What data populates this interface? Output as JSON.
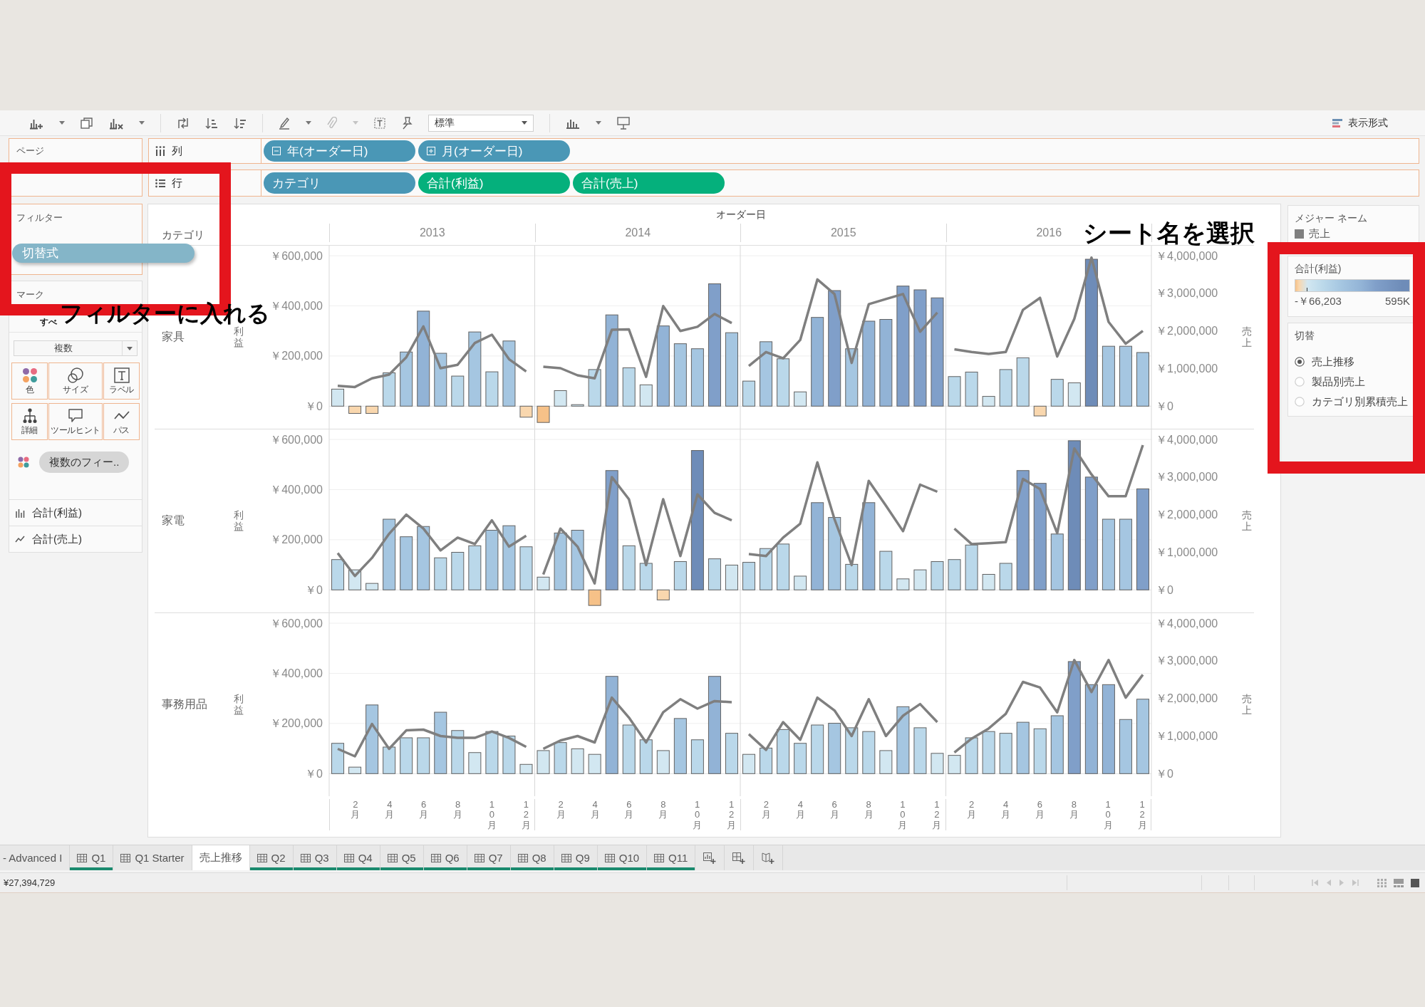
{
  "toolbar": {
    "fit": "標準",
    "show_me": "表示形式"
  },
  "shelves": {
    "pages": {
      "label": "ページ"
    },
    "columns": {
      "label": "列",
      "pills": [
        {
          "label": "年(オーダー日)",
          "kind": "discrete",
          "expanded": true
        },
        {
          "label": "月(オーダー日)",
          "kind": "discrete",
          "expanded": false
        }
      ]
    },
    "rows": {
      "label": "行",
      "pills": [
        {
          "label": "カテゴリ",
          "kind": "discrete"
        },
        {
          "label": "合計(利益)",
          "kind": "continuous"
        },
        {
          "label": "合計(売上)",
          "kind": "continuous"
        }
      ]
    }
  },
  "filters": {
    "label": "フィルター",
    "dragged_pill": {
      "label": "切替式",
      "kind": "discrete"
    },
    "callout": "フィルターに入れる"
  },
  "marks": {
    "label": "マーク",
    "all_tab": {
      "label": "すべ",
      "selected": true
    },
    "mark_type": "複数",
    "buttons": [
      {
        "label": "色",
        "kind": "color"
      },
      {
        "label": "サイズ",
        "kind": "size"
      },
      {
        "label": "ラベル",
        "kind": "label"
      },
      {
        "label": "詳細",
        "kind": "detail"
      },
      {
        "label": "ツールヒント",
        "kind": "tooltip"
      },
      {
        "label": "パス",
        "kind": "path"
      }
    ],
    "fields": [
      {
        "label": "複数のフィー..",
        "kind": "color"
      }
    ],
    "measure_tabs": [
      {
        "label": "合計(利益)",
        "kind": "bar",
        "selected": false
      },
      {
        "label": "合計(売上)",
        "kind": "line",
        "selected": false
      }
    ]
  },
  "view": {
    "row_header": "カテゴリ",
    "column_header": "オーダー日",
    "years": [
      "2013",
      "2014",
      "2015",
      "2016"
    ],
    "rows": [
      {
        "label": "家具"
      },
      {
        "label": "家電"
      },
      {
        "label": "事務用品"
      }
    ],
    "chart_data": [
      {
        "type": "bar",
        "ylabel": "利益",
        "y2label": "売上",
        "grid": true,
        "series": [
          {
            "values": [
              68000,
              -29000,
              -29000,
              133000,
              216000,
              379000,
              211000,
              120000,
              296000,
              137000,
              260000,
              -44000,
              -65000,
              62000,
              6000,
              146000,
              364000,
              153000,
              85000,
              320000,
              249000,
              229000,
              488000,
              293000,
              100000,
              257000,
              189000,
              57000,
              354000,
              461000,
              229000,
              339000,
              346000,
              479000,
              464000,
              432000,
              118000,
              136000,
              39000,
              146000,
              193000,
              -39000,
              107000,
              93000,
              586000,
              239000,
              239000,
              214000
            ],
            "colors": [
              "#d2e7f1",
              "#f9d7ae",
              "#f9d7ae",
              "#bad8ea",
              "#a5c6e1",
              "#92b3d6",
              "#a5c6e1",
              "#bad8ea",
              "#a5c6e1",
              "#bad8ea",
              "#a5c6e1",
              "#f9d7ae",
              "#f6c188",
              "#d2e7f1",
              "#d2e7f1",
              "#bad8ea",
              "#92b3d6",
              "#bad8ea",
              "#d2e7f1",
              "#92b3d6",
              "#a5c6e1",
              "#a5c6e1",
              "#809fc9",
              "#a5c6e1",
              "#bad8ea",
              "#a5c6e1",
              "#bad8ea",
              "#d2e7f1",
              "#92b3d6",
              "#809fc9",
              "#a5c6e1",
              "#92b3d6",
              "#92b3d6",
              "#809fc9",
              "#809fc9",
              "#809fc9",
              "#bad8ea",
              "#bad8ea",
              "#d2e7f1",
              "#bad8ea",
              "#bad8ea",
              "#f9d7ae",
              "#bad8ea",
              "#d2e7f1",
              "#6e8cb8",
              "#a5c6e1",
              "#a5c6e1",
              "#a5c6e1"
            ]
          },
          {
            "type": "line",
            "axis": "y2",
            "color": "#7f7f7f",
            "values": [
              540000,
              510000,
              740000,
              840000,
              1300000,
              2120000,
              1010000,
              1100000,
              1680000,
              1900000,
              1250000,
              920000,
              1050000,
              1010000,
              820000,
              740000,
              2030000,
              2040000,
              780000,
              2660000,
              2000000,
              2110000,
              2450000,
              2210000,
              1070000,
              1440000,
              1270000,
              1760000,
              3370000,
              2980000,
              1150000,
              2710000,
              2850000,
              2980000,
              1980000,
              2490000,
              1510000,
              1440000,
              1390000,
              1440000,
              2560000,
              2880000,
              1320000,
              2320000,
              3950000,
              2240000,
              1660000,
              2000000
            ]
          }
        ],
        "ylim": [
          -90000,
          640000
        ],
        "y2lim": [
          -600000,
          4266667
        ],
        "yticks": [
          {
            "value": 0,
            "label": "￥0"
          },
          {
            "value": 200000,
            "label": "￥200,000"
          },
          {
            "value": 400000,
            "label": "￥400,000"
          },
          {
            "value": 600000,
            "label": "￥600,000"
          }
        ],
        "y2ticks": [
          {
            "value": 0,
            "label": "￥0"
          },
          {
            "value": 1000000,
            "label": "￥1,000,000"
          },
          {
            "value": 2000000,
            "label": "￥2,000,000"
          },
          {
            "value": 3000000,
            "label": "￥3,000,000"
          },
          {
            "value": 4000000,
            "label": "￥4,000,000"
          }
        ],
        "tick_labels": "y"
      },
      {
        "type": "bar",
        "ylabel": "利益",
        "y2label": "売上",
        "grid": true,
        "series": [
          {
            "values": [
              121000,
              80000,
              26000,
              282000,
              212000,
              253000,
              128000,
              150000,
              176000,
              238000,
              256000,
              172000,
              51000,
              227000,
              238000,
              -62000,
              476000,
              176000,
              106000,
              -40000,
              113000,
              556000,
              124000,
              99000,
              110000,
              165000,
              183000,
              55000,
              348000,
              289000,
              102000,
              348000,
              154000,
              44000,
              80000,
              113000,
              121000,
              179000,
              62000,
              106000,
              476000,
              425000,
              223000,
              595000,
              450000,
              282000,
              282000,
              403000
            ],
            "colors": [
              "#bad8ea",
              "#d2e7f1",
              "#d2e7f1",
              "#a5c6e1",
              "#a5c6e1",
              "#a5c6e1",
              "#bad8ea",
              "#bad8ea",
              "#bad8ea",
              "#a5c6e1",
              "#a5c6e1",
              "#bad8ea",
              "#d2e7f1",
              "#a5c6e1",
              "#a5c6e1",
              "#f6c188",
              "#809fc9",
              "#bad8ea",
              "#bad8ea",
              "#f9d7ae",
              "#bad8ea",
              "#6e8cb8",
              "#bad8ea",
              "#d2e7f1",
              "#bad8ea",
              "#bad8ea",
              "#bad8ea",
              "#d2e7f1",
              "#92b3d6",
              "#a5c6e1",
              "#bad8ea",
              "#92b3d6",
              "#bad8ea",
              "#d2e7f1",
              "#d2e7f1",
              "#bad8ea",
              "#bad8ea",
              "#bad8ea",
              "#d2e7f1",
              "#bad8ea",
              "#809fc9",
              "#809fc9",
              "#a5c6e1",
              "#6e8cb8",
              "#809fc9",
              "#a5c6e1",
              "#a5c6e1",
              "#809fc9"
            ]
          },
          {
            "type": "line",
            "axis": "y2",
            "color": "#7f7f7f",
            "values": [
              980000,
              370000,
              850000,
              1490000,
              2000000,
              1630000,
              1050000,
              1390000,
              1220000,
              1850000,
              1150000,
              1440000,
              410000,
              1630000,
              1150000,
              170000,
              3000000,
              2410000,
              660000,
              2410000,
              900000,
              2540000,
              2050000,
              1850000,
              950000,
              900000,
              1390000,
              1760000,
              3390000,
              1880000,
              660000,
              2900000,
              2240000,
              1560000,
              2800000,
              2610000,
              1630000,
              1220000,
              1240000,
              1270000,
              2950000,
              2680000,
              1510000,
              3760000,
              3070000,
              2490000,
              2490000,
              3850000
            ]
          }
        ],
        "ylim": [
          -90000,
          640000
        ],
        "y2lim": [
          -600000,
          4266667
        ],
        "yticks": [
          {
            "value": 0,
            "label": "￥0"
          },
          {
            "value": 200000,
            "label": "￥200,000"
          },
          {
            "value": 400000,
            "label": "￥400,000"
          },
          {
            "value": 600000,
            "label": "￥600,000"
          }
        ],
        "y2ticks": [
          {
            "value": 0,
            "label": "￥0"
          },
          {
            "value": 1000000,
            "label": "￥1,000,000"
          },
          {
            "value": 2000000,
            "label": "￥2,000,000"
          },
          {
            "value": 3000000,
            "label": "￥3,000,000"
          },
          {
            "value": 4000000,
            "label": "￥4,000,000"
          }
        ],
        "tick_labels": "y"
      },
      {
        "type": "bar",
        "ylabel": "利益",
        "y2label": "売上",
        "grid": true,
        "categories": [
          null,
          "2月",
          null,
          "4月",
          null,
          "6月",
          null,
          "8月",
          null,
          "10月",
          null,
          "12月",
          null,
          "2月",
          null,
          "4月",
          null,
          "6月",
          null,
          "8月",
          null,
          "10月",
          null,
          "12月",
          null,
          "2月",
          null,
          "4月",
          null,
          "6月",
          null,
          "8月",
          null,
          "10月",
          null,
          "12月",
          null,
          "2月",
          null,
          "4月",
          null,
          "6月",
          null,
          "8月",
          null,
          "10月",
          null,
          "12月"
        ],
        "series": [
          {
            "values": [
              121000,
              26000,
              274000,
              106000,
              143000,
              143000,
              245000,
              172000,
              84000,
              168000,
              150000,
              37000,
              92000,
              124000,
              99000,
              77000,
              388000,
              194000,
              135000,
              92000,
              220000,
              135000,
              388000,
              161000,
              77000,
              102000,
              176000,
              121000,
              194000,
              201000,
              183000,
              168000,
              92000,
              267000,
              183000,
              81000,
              73000,
              143000,
              168000,
              161000,
              205000,
              179000,
              231000,
              447000,
              355000,
              355000,
              216000,
              297000
            ],
            "colors": [
              "#bad8ea",
              "#d2e7f1",
              "#a5c6e1",
              "#bad8ea",
              "#bad8ea",
              "#bad8ea",
              "#a5c6e1",
              "#bad8ea",
              "#d2e7f1",
              "#bad8ea",
              "#bad8ea",
              "#d2e7f1",
              "#d2e7f1",
              "#bad8ea",
              "#d2e7f1",
              "#d2e7f1",
              "#92b3d6",
              "#bad8ea",
              "#bad8ea",
              "#d2e7f1",
              "#a5c6e1",
              "#bad8ea",
              "#92b3d6",
              "#bad8ea",
              "#d2e7f1",
              "#bad8ea",
              "#bad8ea",
              "#bad8ea",
              "#bad8ea",
              "#a5c6e1",
              "#bad8ea",
              "#bad8ea",
              "#d2e7f1",
              "#a5c6e1",
              "#bad8ea",
              "#d2e7f1",
              "#d2e7f1",
              "#bad8ea",
              "#bad8ea",
              "#bad8ea",
              "#a5c6e1",
              "#bad8ea",
              "#a5c6e1",
              "#809fc9",
              "#92b3d6",
              "#92b3d6",
              "#a5c6e1",
              "#a5c6e1"
            ]
          },
          {
            "type": "line",
            "axis": "y2",
            "color": "#7f7f7f",
            "values": [
              660000,
              460000,
              1320000,
              660000,
              1150000,
              1170000,
              1000000,
              950000,
              950000,
              1120000,
              950000,
              710000,
              660000,
              880000,
              1000000,
              830000,
              2020000,
              1490000,
              830000,
              1630000,
              1980000,
              1730000,
              1930000,
              1900000,
              1050000,
              630000,
              1370000,
              900000,
              2020000,
              1680000,
              1000000,
              1980000,
              1000000,
              1540000,
              1850000,
              1370000,
              560000,
              930000,
              1200000,
              1590000,
              2440000,
              2290000,
              1630000,
              3020000,
              2170000,
              3020000,
              2020000,
              2630000
            ]
          }
        ],
        "ylim": [
          -90000,
          640000
        ],
        "y2lim": [
          -600000,
          4266667
        ],
        "yticks": [
          {
            "value": 0,
            "label": "￥0"
          },
          {
            "value": 200000,
            "label": "￥200,000"
          },
          {
            "value": 400000,
            "label": "￥400,000"
          },
          {
            "value": 600000,
            "label": "￥600,000"
          }
        ],
        "y2ticks": [
          {
            "value": 0,
            "label": "￥0"
          },
          {
            "value": 1000000,
            "label": "￥1,000,000"
          },
          {
            "value": 2000000,
            "label": "￥2,000,000"
          },
          {
            "value": 3000000,
            "label": "￥3,000,000"
          },
          {
            "value": 4000000,
            "label": "￥4,000,000"
          }
        ]
      }
    ]
  },
  "legends": {
    "measure_names": {
      "title": "メジャー ネーム",
      "items": [
        {
          "label": "売上",
          "color": "#7f7f7f"
        }
      ]
    },
    "profit": {
      "title": "合計(利益)",
      "min_label": "-￥66,203",
      "max_label": "595K"
    }
  },
  "parameter": {
    "title": "切替",
    "options": [
      {
        "label": "売上推移",
        "selected": true
      },
      {
        "label": "製品別売上",
        "selected": false
      },
      {
        "label": "カテゴリ別累積売上",
        "selected": false
      }
    ],
    "callout": "シート名を選択"
  },
  "sheet_tabs": [
    {
      "label": "- Advanced I",
      "kind": "plain",
      "selected": false
    },
    {
      "label": "Q1",
      "kind": "worksheet",
      "selected": false,
      "color": "#1a8a6e"
    },
    {
      "label": "Q1 Starter",
      "kind": "worksheet",
      "selected": false
    },
    {
      "label": "売上推移",
      "kind": "plain",
      "selected": true
    },
    {
      "label": "Q2",
      "kind": "worksheet",
      "selected": false,
      "color": "#1a8a6e"
    },
    {
      "label": "Q3",
      "kind": "worksheet",
      "selected": false,
      "color": "#1a8a6e"
    },
    {
      "label": "Q4",
      "kind": "worksheet",
      "selected": false,
      "color": "#1a8a6e"
    },
    {
      "label": "Q5",
      "kind": "worksheet",
      "selected": false,
      "color": "#1a8a6e"
    },
    {
      "label": "Q6",
      "kind": "worksheet",
      "selected": false,
      "color": "#1a8a6e"
    },
    {
      "label": "Q7",
      "kind": "worksheet",
      "selected": false,
      "color": "#1a8a6e"
    },
    {
      "label": "Q8",
      "kind": "worksheet",
      "selected": false,
      "color": "#1a8a6e"
    },
    {
      "label": "Q9",
      "kind": "worksheet",
      "selected": false,
      "color": "#1a8a6e"
    },
    {
      "label": "Q10",
      "kind": "worksheet",
      "selected": false,
      "color": "#1a8a6e"
    },
    {
      "label": "Q11",
      "kind": "worksheet",
      "selected": false,
      "color": "#1a8a6e"
    }
  ],
  "status_bar": {
    "total": "¥27,394,729"
  }
}
